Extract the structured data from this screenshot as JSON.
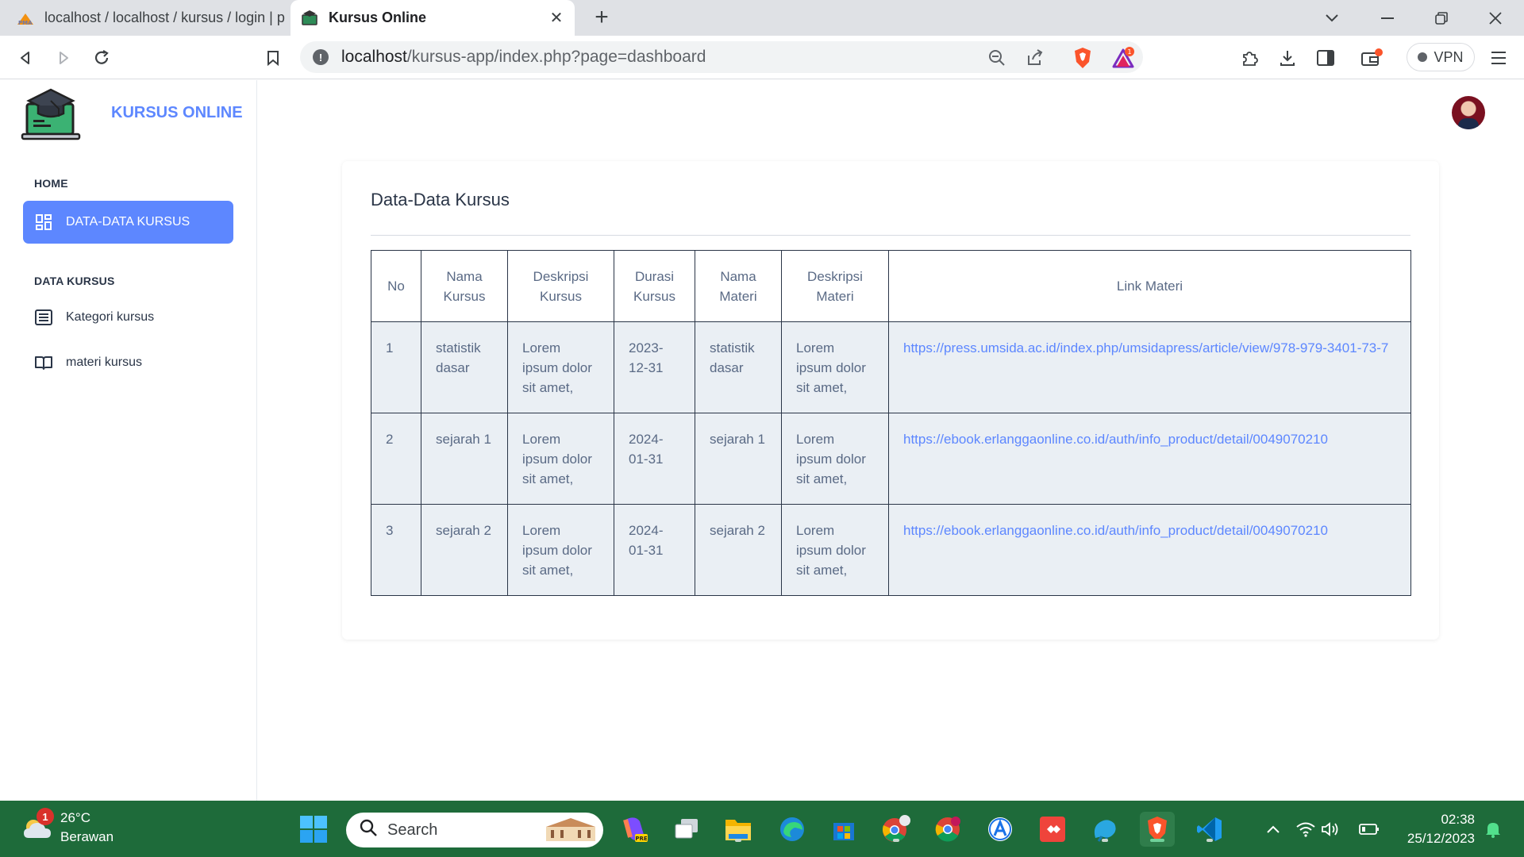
{
  "browser": {
    "tabs": [
      {
        "label": "localhost / localhost / kursus / login | p",
        "state": "inactive"
      },
      {
        "label": "Kursus Online",
        "state": "active"
      }
    ],
    "url_host": "localhost",
    "url_path": "/kursus-app/index.php?page=dashboard",
    "vpn_label": "VPN",
    "badge_count": "1"
  },
  "sidebar": {
    "brand": "KURSUS ONLINE",
    "home_caption": "HOME",
    "active_item": "DATA-DATA KURSUS",
    "data_caption": "DATA KURSUS",
    "items": [
      {
        "label": "Kategori kursus",
        "icon": "list-icon"
      },
      {
        "label": "materi kursus",
        "icon": "book-icon"
      }
    ]
  },
  "main": {
    "title": "Data-Data Kursus",
    "columns": [
      "No",
      "Nama Kursus",
      "Deskripsi Kursus",
      "Durasi Kursus",
      "Nama Materi",
      "Deskripsi Materi",
      "Link Materi"
    ],
    "rows": [
      {
        "no": "1",
        "nama_kursus": "statistik dasar",
        "deskripsi_kursus": "Lorem ipsum dolor sit amet,",
        "durasi": "2023-12-31",
        "nama_materi": "statistik dasar",
        "deskripsi_materi": "Lorem ipsum dolor sit amet,",
        "link": "https://press.umsida.ac.id/index.php/umsidapress/article/view/978-979-3401-73-7"
      },
      {
        "no": "2",
        "nama_kursus": "sejarah 1",
        "deskripsi_kursus": "Lorem ipsum dolor sit amet,",
        "durasi": "2024-01-31",
        "nama_materi": "sejarah 1",
        "deskripsi_materi": "Lorem ipsum dolor sit amet,",
        "link": "https://ebook.erlanggaonline.co.id/auth/info_product/detail/0049070210"
      },
      {
        "no": "3",
        "nama_kursus": "sejarah 2",
        "deskripsi_kursus": "Lorem ipsum dolor sit amet,",
        "durasi": "2024-01-31",
        "nama_materi": "sejarah 2",
        "deskripsi_materi": "Lorem ipsum dolor sit amet,",
        "link": "https://ebook.erlanggaonline.co.id/auth/info_product/detail/0049070210"
      }
    ]
  },
  "taskbar": {
    "weather_temp": "26°C",
    "weather_desc": "Berawan",
    "weather_badge": "1",
    "search_label": "Search",
    "time": "02:38",
    "date": "25/12/2023"
  },
  "colors": {
    "accent": "#5d87ff",
    "taskbar": "#1e6b3a",
    "row_bg": "#eaeff4"
  }
}
